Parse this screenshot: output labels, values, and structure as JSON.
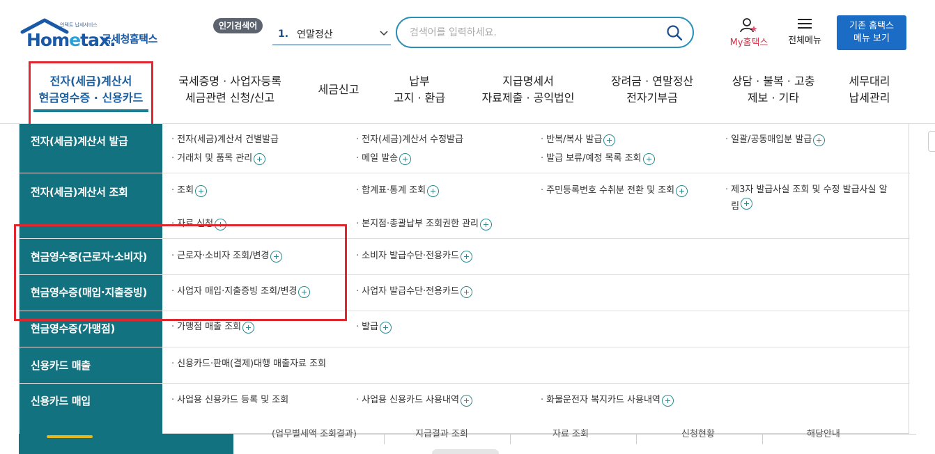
{
  "header": {
    "logo_brand": "Hometax",
    "logo_tagline": "언택트 납세서비스",
    "logo_name": "국세청홈택스",
    "popular_label": "인기검색어",
    "popular_rank": "1.",
    "popular_term": "연말정산",
    "search_placeholder": "검색어를 입력하세요.",
    "my_hometax": "My홈택스",
    "all_menu": "전체메뉴",
    "legacy_line1": "기존 홈택스",
    "legacy_line2": "메뉴 보기"
  },
  "gnb": [
    {
      "line1": "전자(세금)계산서",
      "line2": "현금영수증 · 신용카드",
      "active": true
    },
    {
      "line1": "국세증명 · 사업자등록",
      "line2": "세금관련 신청/신고"
    },
    {
      "line1": "세금신고",
      "line2": ""
    },
    {
      "line1": "납부",
      "line2": "고지 · 환급"
    },
    {
      "line1": "지급명세서",
      "line2": "자료제출 · 공익법인"
    },
    {
      "line1": "장려금 · 연말정산",
      "line2": "전자기부금"
    },
    {
      "line1": "상담 · 불복 · 고충",
      "line2": "제보 · 기타"
    },
    {
      "line1": "세무대리",
      "line2": "납세관리"
    }
  ],
  "mega": {
    "rows": [
      {
        "category": "전자(세금)계산서 발급",
        "links": [
          "전자(세금)계산서 건별발급",
          "전자(세금)계산서 수정발급",
          "반복/복사 발급",
          "일괄/공동매입분 발급",
          "거래처 및 품목 관리",
          "메일 발송",
          "발급 보류/예정 목록 조회"
        ]
      },
      {
        "category": "전자(세금)계산서 조회",
        "links": [
          "조회",
          "합계표·통계 조회",
          "주민등록번호 수취분 전환 및 조회",
          "제3자 발급사실 조회 및 수정 발급사실 알림",
          "자료 신청",
          "본지점·총괄납부 조회권한 관리"
        ]
      },
      {
        "category": "현금영수증(근로자·소비자)",
        "links": [
          "근로자·소비자 조회/변경",
          "소비자 발급수단·전용카드"
        ]
      },
      {
        "category": "현금영수증(매입·지출증빙)",
        "links": [
          "사업자 매입·지출증빙 조회/변경",
          "사업자 발급수단·전용카드"
        ]
      },
      {
        "category": "현금영수증(가맹점)",
        "links": [
          "가맹점 매출 조회",
          "발급"
        ]
      },
      {
        "category": "신용카드 매출",
        "links": [
          "신용카드·판매(결제)대행 매출자료 조회"
        ]
      },
      {
        "category": "신용카드 매입",
        "links": [
          "사업용 신용카드 등록 및 조회",
          "사업용 신용카드 사용내역",
          "화물운전자 복지카드 사용내역"
        ]
      }
    ]
  },
  "background_tabs": [
    "(업무별세액 조회결과)",
    "지급결과 조회",
    "자료 조회",
    "신청현황",
    "해당안내"
  ],
  "colors": {
    "teal": "#13727f",
    "brand_blue": "#1a59a8",
    "highlight_red": "#e0262e",
    "legacy_button": "#1b6cc4"
  },
  "icons": [
    "house-logo-icon",
    "chevron-down-icon",
    "search-icon",
    "user-star-icon",
    "hamburger-icon",
    "plus-circle-icon"
  ]
}
